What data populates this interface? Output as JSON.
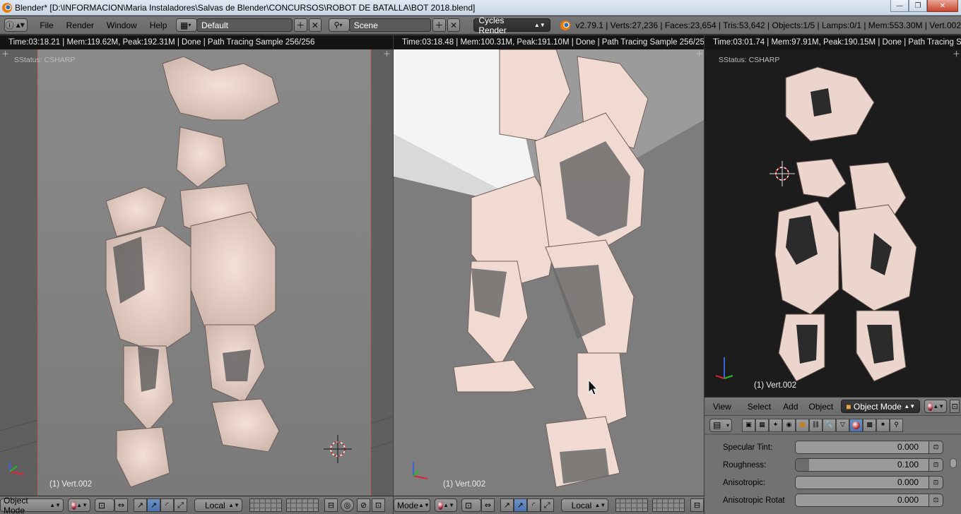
{
  "window": {
    "title": "Blender* [D:\\INFORMACION\\Maria Instaladores\\Salvas de Blender\\CONCURSOS\\ROBOT DE BATALLA\\BOT 2018.blend]",
    "minimize": "—",
    "maximize": "❐",
    "close": "✕"
  },
  "info_header": {
    "editor_icon": "ⓘ",
    "menus": [
      "File",
      "Render",
      "Window",
      "Help"
    ],
    "layout": "Default",
    "scene": "Scene",
    "render_engine": "Cycles Render",
    "stats": "v2.79.1 | Verts:27,236 | Faces:23,654 | Tris:53,642 | Objects:1/5 | Lamps:0/1 | Mem:553.30M | Vert.002"
  },
  "viewports": [
    {
      "id": "left",
      "header": "Time:03:18.21 | Mem:119.62M, Peak:192.31M | Done | Path Tracing Sample 256/256",
      "status": "SStatus: CSHARP",
      "object_label": "(1) Vert.002",
      "bg_color": "#7a7a7a"
    },
    {
      "id": "middle",
      "header": "Time:03:18.48 | Mem:100.31M, Peak:191.10M | Done | Path Tracing Sample 256/25",
      "object_label": "(1) Vert.002",
      "bg_color": "#7c7c7c"
    },
    {
      "id": "right",
      "header": "Time:03:01.74 | Mem:97.91M, Peak:190.15M | Done | Path Tracing Sa",
      "status": "SStatus: CSHARP",
      "object_label": "(1) Vert.002",
      "bg_color": "#1d1d1d"
    }
  ],
  "bottom_bar_left": {
    "mode": "Object Mode",
    "pivot": "Local"
  },
  "bottom_bar_middle": {
    "mode": "Mode",
    "pivot": "Local"
  },
  "props_header": {
    "menus": [
      "View",
      "Select",
      "Add",
      "Object"
    ],
    "mode": "Object Mode"
  },
  "properties": [
    {
      "label": "Specular Tint:",
      "value": "0.000",
      "fill": 0.0
    },
    {
      "label": "Roughness:",
      "value": "0.100",
      "fill": 0.1
    },
    {
      "label": "Anisotropic:",
      "value": "0.000",
      "fill": 0.0
    },
    {
      "label": "Anisotropic Rotat",
      "value": "0.000",
      "fill": 0.0
    }
  ],
  "icons": {
    "app": "blender-logo-icon",
    "crosshair": "3d-cursor-icon",
    "axis": "axis-gizmo-icon"
  }
}
